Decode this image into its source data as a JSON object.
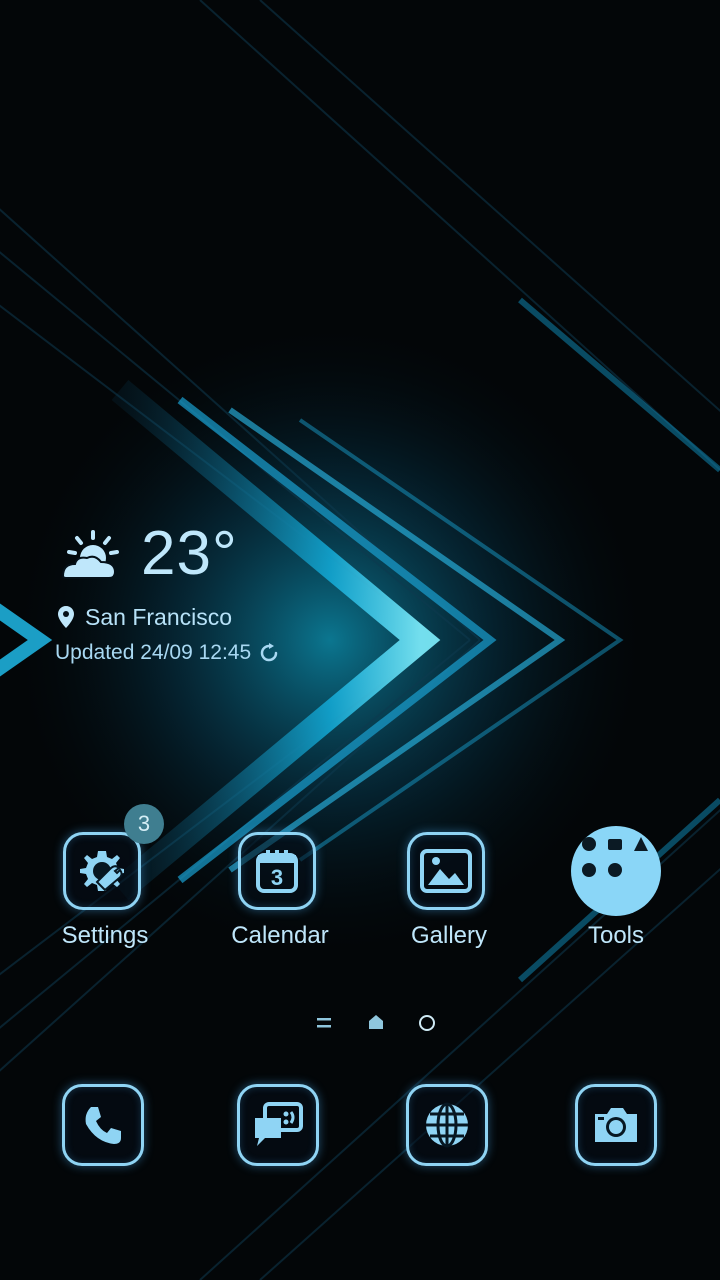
{
  "weather": {
    "temperature": "23°",
    "city": "San Francisco",
    "updated": "Updated 24/09 12:45",
    "condition_icon": "partly-sunny-icon"
  },
  "apps": [
    {
      "label": "Settings",
      "icon": "gear-wrench-icon",
      "badge": "3"
    },
    {
      "label": "Calendar",
      "icon": "calendar-icon",
      "day": "3"
    },
    {
      "label": "Gallery",
      "icon": "image-icon"
    },
    {
      "label": "Tools",
      "icon": "folder-icon"
    }
  ],
  "page_indicator": [
    "menu-lines-icon",
    "home-icon",
    "circle-icon"
  ],
  "dock": [
    "phone-icon",
    "messages-icon",
    "browser-globe-icon",
    "camera-icon"
  ],
  "colors": {
    "accent": "#8fd4f4",
    "folder": "#8ad6f7",
    "badge": "#3f7e90",
    "glow": "#00c8ff"
  }
}
